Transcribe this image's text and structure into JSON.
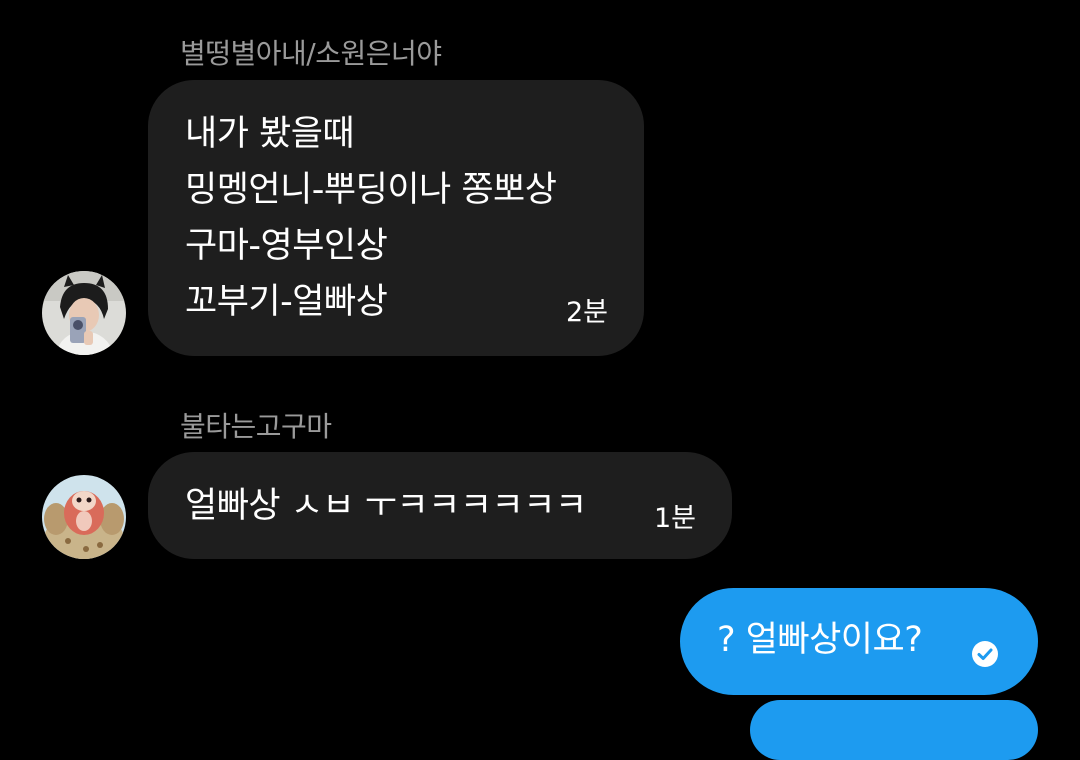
{
  "colors": {
    "background": "#000000",
    "incoming_bubble": "#1e1e1e",
    "outgoing_bubble": "#1d9bf0",
    "sender_name": "#9a9a9a",
    "text": "#ffffff"
  },
  "messages": [
    {
      "sender": "별떵별아내/소원은너야",
      "direction": "incoming",
      "avatar_icon": "photo-avatar-icon",
      "lines": [
        "내가 봤을때",
        "밍멩언니-뿌딩이나 쫑뽀상",
        "구마-영부인상",
        "꼬부기-얼빠상"
      ],
      "time": "2분"
    },
    {
      "sender": "불타는고구마",
      "direction": "incoming",
      "avatar_icon": "cartoon-avatar-icon",
      "lines": [
        "얼빠상 ㅅㅂ ㅜㅋㅋㅋㅋㅋㅋ"
      ],
      "time": "1분"
    },
    {
      "direction": "outgoing",
      "text": "? 얼빠상이요?",
      "status_icon": "read-check-icon"
    }
  ]
}
